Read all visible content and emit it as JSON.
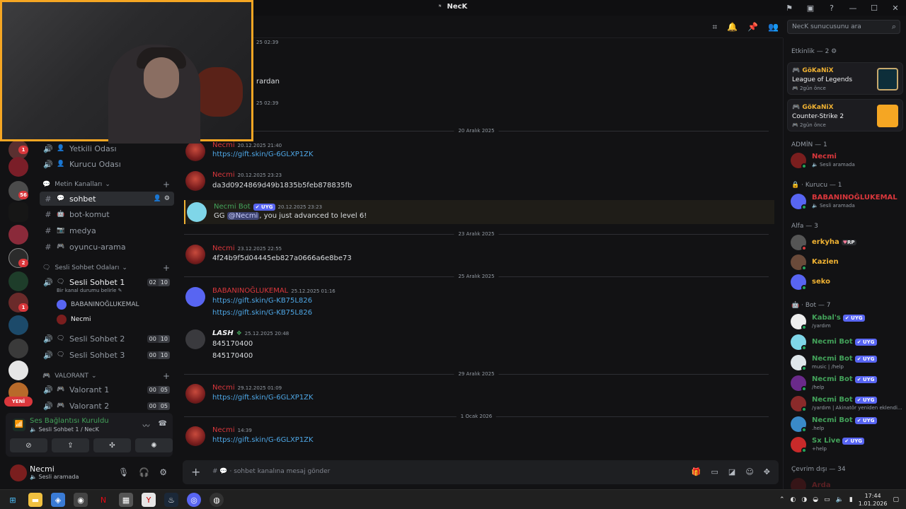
{
  "window": {
    "title": "NecK",
    "icon": "discord-server-icon"
  },
  "search": {
    "placeholder": "NecK sunucusunu ara"
  },
  "partials": {
    "line1": "25 02:39",
    "line2": "rardan",
    "line3": "25 02:39"
  },
  "server_rail": {
    "badges": [
      "1",
      "56",
      "2",
      "1"
    ],
    "new_label": "YENİ"
  },
  "channels": {
    "top": [
      {
        "label": "Yetkili Odası",
        "icon": "speaker-icon",
        "emoji": "person-icon"
      },
      {
        "label": "Kurucu Odası",
        "icon": "speaker-icon",
        "emoji": "person-icon"
      }
    ],
    "text_category": "Metin Kanalları",
    "text": [
      {
        "label": "sohbet",
        "emoji": "speech-icon",
        "active": true
      },
      {
        "label": "bot-komut",
        "emoji": "robot-icon"
      },
      {
        "label": "medya",
        "emoji": "camera-icon"
      },
      {
        "label": "oyuncu-arama",
        "emoji": "gamepad-icon"
      }
    ],
    "voice_category": "Sesli Sohbet Odaları",
    "voice": [
      {
        "label": "Sesli Sohbet 1",
        "status": "Bir kanal durumu belirle",
        "count_a": "02",
        "count_b": "10"
      },
      {
        "label": "Sesli Sohbet 2",
        "count_a": "00",
        "count_b": "10"
      },
      {
        "label": "Sesli Sohbet 3",
        "count_a": "00",
        "count_b": "10"
      }
    ],
    "voice_users": [
      {
        "name": "BABANINOĞLUKEMAL"
      },
      {
        "name": "Necmi"
      }
    ],
    "valorant_category": "VALORANT",
    "valorant": [
      {
        "label": "Valorant 1",
        "count_a": "00",
        "count_b": "05"
      },
      {
        "label": "Valorant 2",
        "count_a": "00",
        "count_b": "05"
      }
    ]
  },
  "voice_panel": {
    "title": "Ses Bağlantısı Kuruldu",
    "subtitle": "Sesli Sohbet 1 / NecK"
  },
  "user": {
    "name": "Necmi",
    "status": "Sesli aramada"
  },
  "messages": {
    "d1": "20 Aralık 2025",
    "m1": {
      "author": "Necmi",
      "time": "20.12.2025 21:40",
      "text": "https://gift.skin/G-6GLXP1ZK"
    },
    "m2": {
      "author": "Necmi",
      "time": "20.12.2025 23:23",
      "text": "da3d0924869d49b1835b5feb878835fb"
    },
    "m3": {
      "author": "Necmi Bot",
      "tag": "✔ UYG",
      "time": "20.12.2025 23:23",
      "pre": "GG ",
      "mention": "@Necmi",
      "post": ", you just advanced to level 6!"
    },
    "d2": "23 Aralık 2025",
    "m4": {
      "author": "Necmi",
      "time": "23.12.2025 22:55",
      "text": "4f24b9f5d04445eb827a0666a6e8be73"
    },
    "d3": "25 Aralık 2025",
    "m5": {
      "author": "BABANINOĞLUKEMAL",
      "time": "25.12.2025 01:16",
      "text1": "https://gift.skin/G-KB75L826",
      "text2": "https://gift.skin/G-KB75L826"
    },
    "m6": {
      "author": "LASH",
      "time": "25.12.2025 20:48",
      "text1": "845170400",
      "text2": "845170400"
    },
    "d4": "29 Aralık 2025",
    "m7": {
      "author": "Necmi",
      "time": "29.12.2025 01:09",
      "text": "https://gift.skin/G-6GLXP1ZK"
    },
    "d5": "1 Ocak 2026",
    "m8": {
      "author": "Necmi",
      "time": "14:39",
      "text": "https://gift.skin/G-6GLXP1ZK"
    }
  },
  "composer": {
    "placeholder": "sohbet kanalına mesaj gönder"
  },
  "members": {
    "activity_header": "Etkinlik — 2",
    "activities": [
      {
        "user": "GöKaNiX",
        "game": "League of Legends",
        "time": "2gün önce"
      },
      {
        "user": "GöKaNiX",
        "game": "Counter-Strike 2",
        "time": "2gün önce"
      }
    ],
    "admin_header": "ADMİN — 1",
    "admin": [
      {
        "name": "Necmi",
        "sub": "Sesli aramada"
      }
    ],
    "kurucu_header": "Kurucu — 1",
    "kurucu": [
      {
        "name": "BABANINOĞLUKEMAL",
        "sub": "Sesli aramada"
      }
    ],
    "alfa_header": "Alfa — 3",
    "alfa": [
      {
        "name": "erkyha",
        "badge": "RP"
      },
      {
        "name": "Kazien"
      },
      {
        "name": "seko"
      }
    ],
    "bot_header": "Bot — 7",
    "bots": [
      {
        "name": "Kabal's",
        "tag": "✔ UYG",
        "sub": "/yardım"
      },
      {
        "name": "Necmi Bot",
        "tag": "✔ UYG",
        "sub": ""
      },
      {
        "name": "Necmi Bot",
        "tag": "✔ UYG",
        "sub": "music | /help"
      },
      {
        "name": "Necmi Bot",
        "tag": "✔ UYG",
        "sub": "/help"
      },
      {
        "name": "Necmi Bot",
        "tag": "✔ UYG",
        "sub": "/yardım | Akinatör yeniden eklendi..."
      },
      {
        "name": "Necmi Bot",
        "tag": "✔ UYG",
        "sub": ".help"
      },
      {
        "name": "Sx Live",
        "tag": "✔ UYG",
        "sub": "+help"
      }
    ],
    "offline_header": "Çevrim dışı — 34",
    "offline": [
      {
        "name": "Arda"
      }
    ]
  },
  "taskbar": {
    "time": "17:44",
    "date": "1.01.2026"
  },
  "colors": {
    "accent": "#5865f2",
    "online": "#23a55a",
    "red_name": "#da373c",
    "green_name": "#43a25a",
    "gold_name": "#f0b232",
    "link": "#4ea7e6"
  }
}
